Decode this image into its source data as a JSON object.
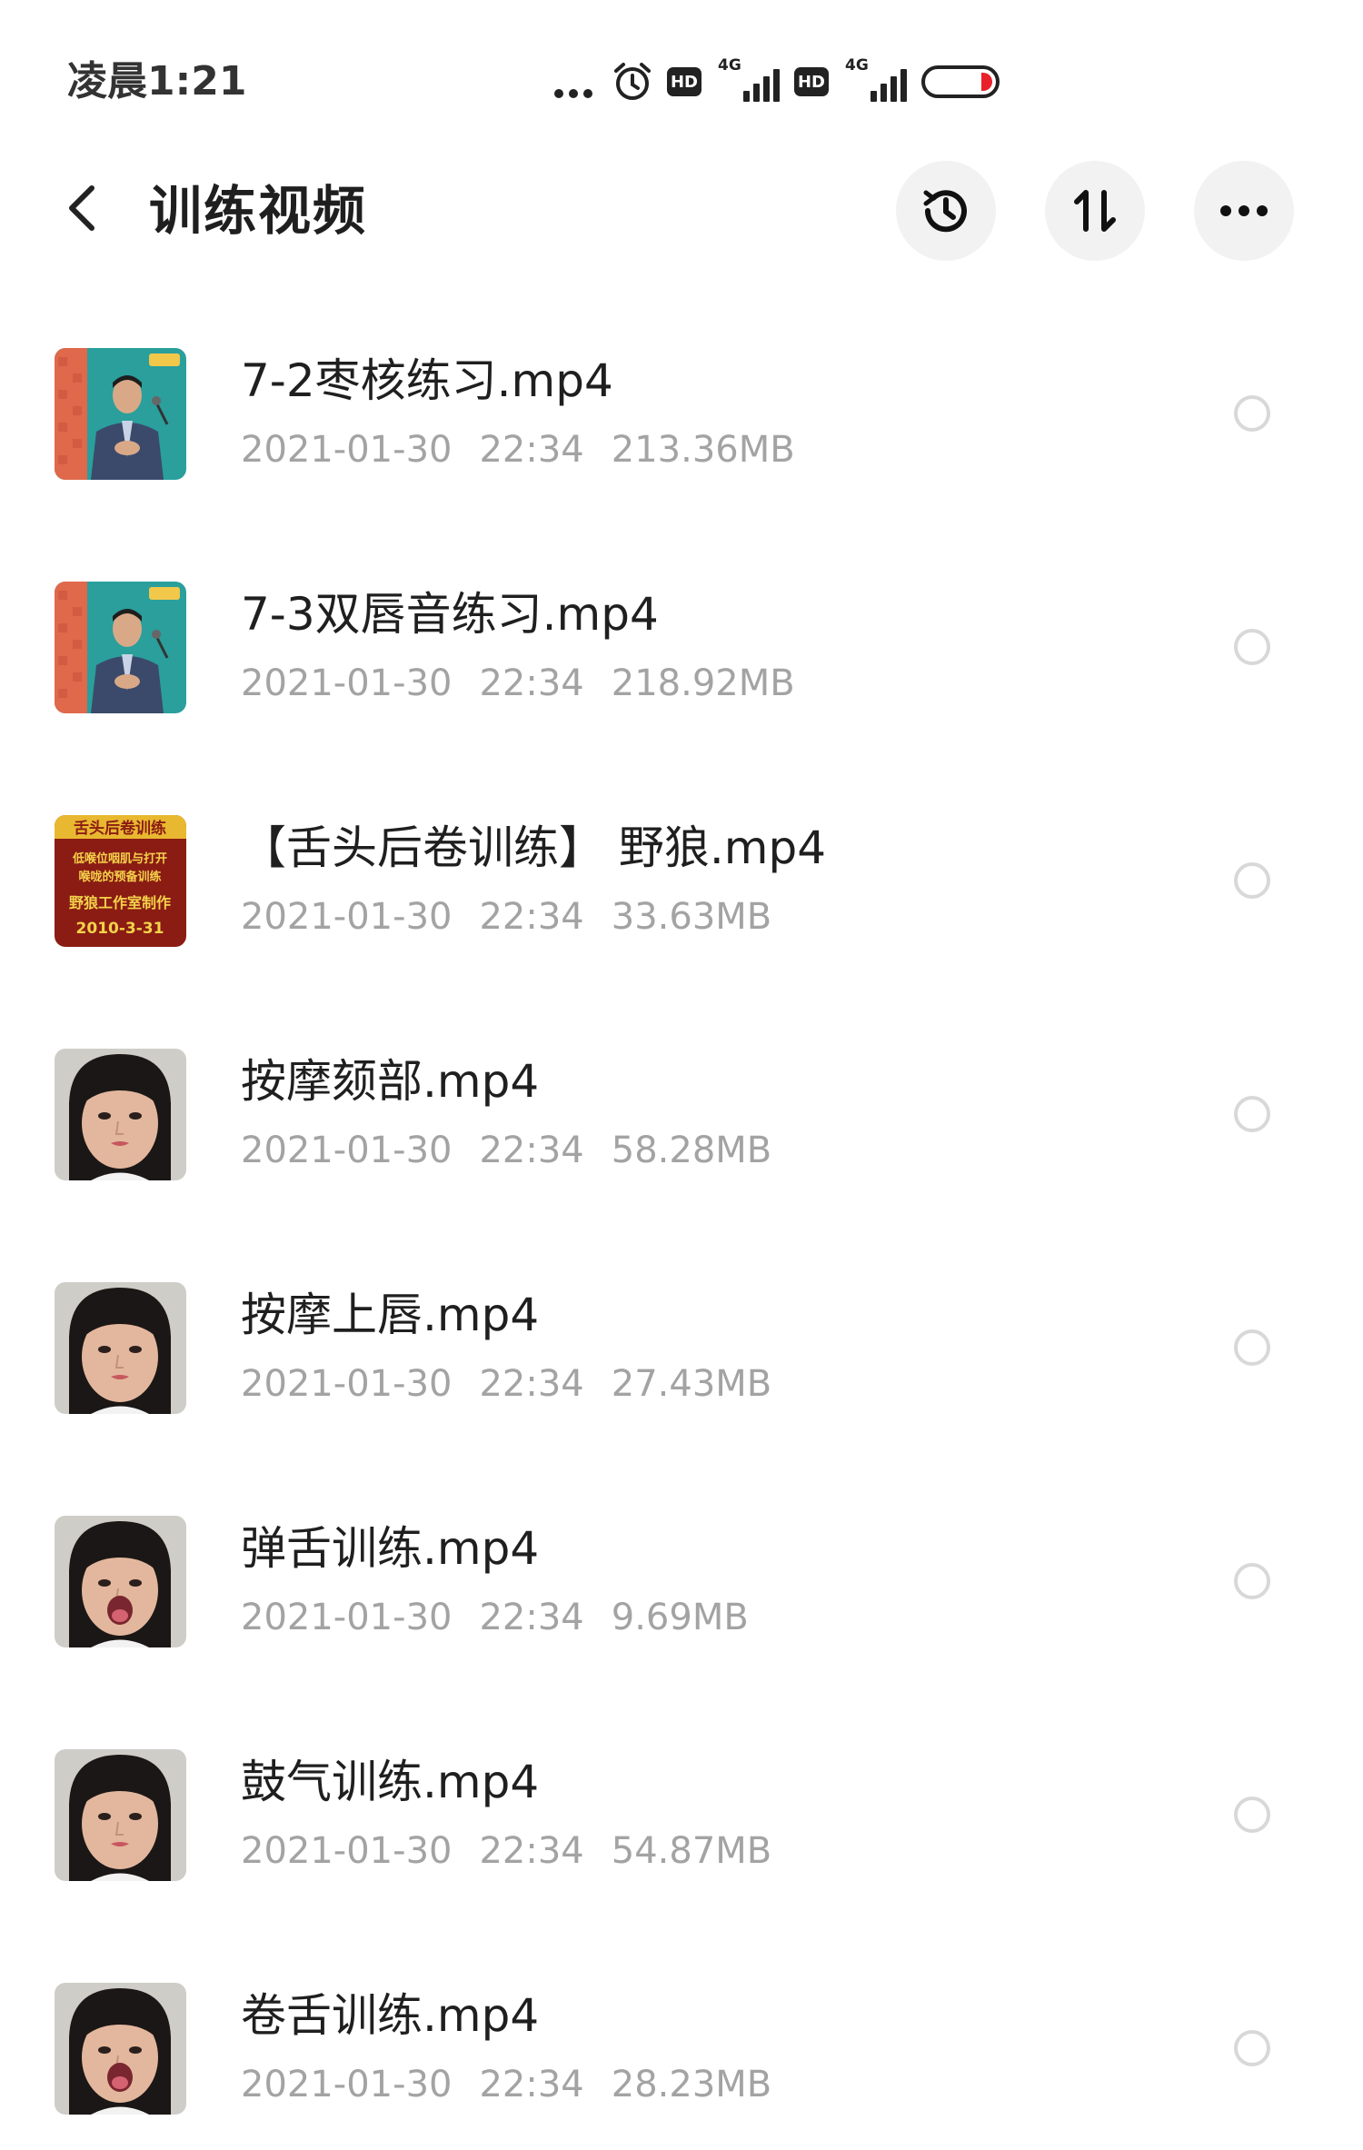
{
  "status_bar": {
    "time": "凌晨1:21",
    "hd_label": "HD",
    "network_label": "4G",
    "battery_color": "#e8202a",
    "icons": [
      "more-dots-icon",
      "alarm-icon",
      "hd-icon",
      "signal-4g-icon",
      "hd-icon",
      "signal-4g-icon",
      "battery-icon"
    ]
  },
  "header": {
    "title": "训练视频",
    "back_icon": "chevron-left-icon",
    "history_icon": "history-clock-icon",
    "sort_icon": "sort-arrows-icon",
    "more_icon": "more-horizontal-icon"
  },
  "files": [
    {
      "name": "7-2枣核练习.mp4",
      "date": "2021-01-30",
      "time": "22:34",
      "size": "213.36MB",
      "thumb": "man-studio"
    },
    {
      "name": "7-3双唇音练习.mp4",
      "date": "2021-01-30",
      "time": "22:34",
      "size": "218.92MB",
      "thumb": "man-studio"
    },
    {
      "name": "【舌头后卷训练】 野狼.mp4",
      "date": "2021-01-30",
      "time": "22:34",
      "size": "33.63MB",
      "thumb": "title-card",
      "thumb_text": [
        "舌头后卷训练",
        "低喉位咽肌与打开",
        "喉咙的预备训练",
        "野狼工作室制作",
        "2010-3-31"
      ]
    },
    {
      "name": "按摩颏部.mp4",
      "date": "2021-01-30",
      "time": "22:34",
      "size": "58.28MB",
      "thumb": "woman-face"
    },
    {
      "name": "按摩上唇.mp4",
      "date": "2021-01-30",
      "time": "22:34",
      "size": "27.43MB",
      "thumb": "woman-face"
    },
    {
      "name": "弹舌训练.mp4",
      "date": "2021-01-30",
      "time": "22:34",
      "size": "9.69MB",
      "thumb": "woman-face-open"
    },
    {
      "name": "鼓气训练.mp4",
      "date": "2021-01-30",
      "time": "22:34",
      "size": "54.87MB",
      "thumb": "woman-face"
    },
    {
      "name": "卷舌训练.mp4",
      "date": "2021-01-30",
      "time": "22:34",
      "size": "28.23MB",
      "thumb": "woman-face-open"
    }
  ]
}
